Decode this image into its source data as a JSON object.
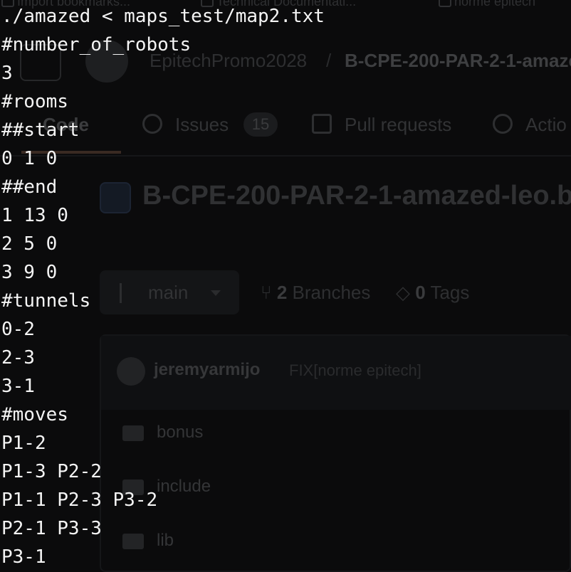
{
  "background": {
    "bookmarks": [
      "Import bookmarks...",
      "Technical Documentati...",
      "norme epitech"
    ],
    "breadcrumb": {
      "org": "EpitechPromo2028",
      "separator": "/",
      "repo": "B-CPE-200-PAR-2-1-amaze"
    },
    "tabs": {
      "code": "Code",
      "issues": "Issues",
      "issues_count": "15",
      "pull_requests": "Pull requests",
      "actions": "Actio"
    },
    "repo_title": "B-CPE-200-PAR-2-1-amazed-leo.ba",
    "branch": "main",
    "branches_count": "2",
    "branches_label": "Branches",
    "tags_count": "0",
    "tags_label": "Tags",
    "commit": {
      "author": "jeremyarmijo",
      "message": "FIX[norme epitech]"
    },
    "files": [
      "bonus",
      "include",
      "lib"
    ]
  },
  "terminal": {
    "lines": [
      "./amazed < maps_test/map2.txt",
      "#number_of_robots",
      "3",
      "#rooms",
      "##start",
      "0 1 0",
      "##end",
      "1 13 0",
      "2 5 0",
      "3 9 0",
      "#tunnels",
      "0-2",
      "2-3",
      "3-1",
      "#moves",
      "P1-2",
      "P1-3 P2-2",
      "P1-1 P2-3 P3-2",
      "P2-1 P3-3",
      "P3-1"
    ]
  }
}
